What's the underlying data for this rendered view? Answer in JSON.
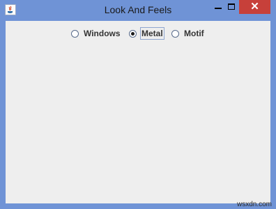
{
  "window": {
    "title": "Look And Feels",
    "close_glyph": "✕"
  },
  "radios": [
    {
      "label": "Windows",
      "checked": false
    },
    {
      "label": "Metal",
      "checked": true
    },
    {
      "label": "Motif",
      "checked": false
    }
  ],
  "watermark": "wsxdn.com",
  "icons": {
    "app": "java-app-icon"
  }
}
